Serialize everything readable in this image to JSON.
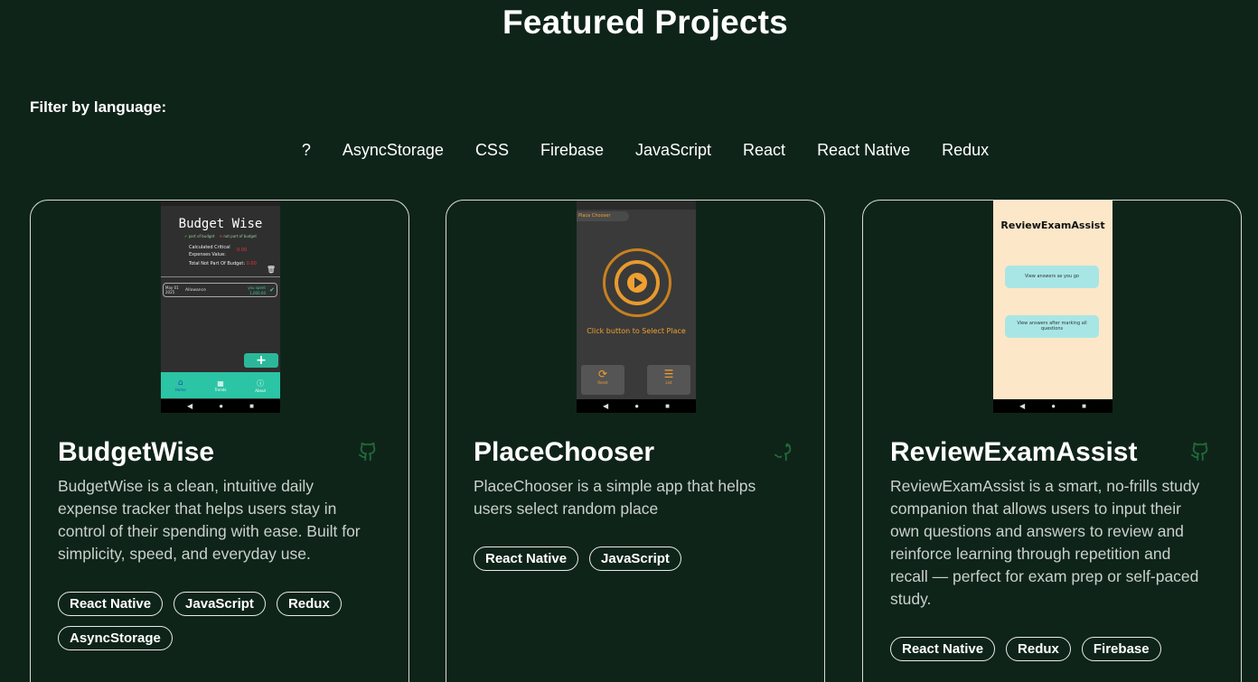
{
  "header": {
    "title": "Featured Projects"
  },
  "filter": {
    "label": "Filter by language:",
    "options": [
      "?",
      "AsyncStorage",
      "CSS",
      "Firebase",
      "JavaScript",
      "React",
      "React Native",
      "Redux"
    ]
  },
  "projects": [
    {
      "title": "BudgetWise",
      "description": "BudgetWise is a clean, intuitive daily expense tracker that helps users stay in control of their spending with ease. Built for simplicity, speed, and everyday use.",
      "tags": [
        "React Native",
        "JavaScript",
        "Redux",
        "AsyncStorage"
      ],
      "screenshot": {
        "app_title": "Budget Wise",
        "legend_part": "part of budget",
        "legend_not_part": "not part of budget",
        "critical_label": "Calculated Critical Expenses Value:",
        "critical_value": "0.00",
        "not_part_label": "Total Not Part Of Budget:",
        "not_part_value": "0.00",
        "entry_date": "May 01 2025",
        "entry_name": "Allowance",
        "entry_spent_label": "you spent",
        "entry_amount": "1,000.00",
        "tab_home": "Home",
        "tab_trends": "Trends",
        "tab_about": "About"
      }
    },
    {
      "title": "PlaceChooser",
      "description": "PlaceChooser is a simple app that helps users select random place",
      "tags": [
        "React Native",
        "JavaScript"
      ],
      "screenshot": {
        "app_title": "Place Chooser",
        "prompt": "Click button to Select Place",
        "reset_label": "Reset",
        "list_label": "List"
      }
    },
    {
      "title": "ReviewExamAssist",
      "description": "ReviewExamAssist is a smart, no-frills study companion that allows users to input their own questions and answers to review and reinforce learning through repetition and recall — perfect for exam prep or self-paced study.",
      "tags": [
        "React Native",
        "Redux",
        "Firebase"
      ],
      "screenshot": {
        "app_title": "ReviewExamAssist",
        "button_1": "View answers as you go",
        "button_2": "View answers after marking all questions"
      }
    }
  ],
  "icons": {
    "repo_link": "github-icon"
  },
  "colors": {
    "background": "#0f2419",
    "card_border": "#d6ddd8",
    "text_secondary": "#c9d1cc",
    "github_icon": "#1f6b3a"
  }
}
